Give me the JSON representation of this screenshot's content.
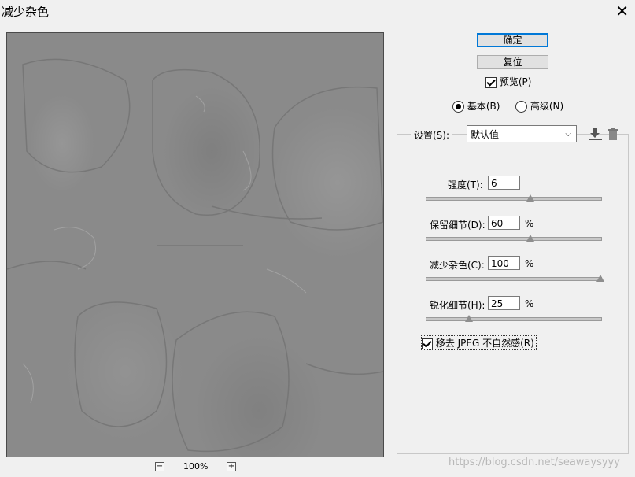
{
  "window": {
    "title": "减少杂色",
    "close_glyph": "✕"
  },
  "preview": {
    "zoom_out": "−",
    "zoom_in": "+",
    "zoom_level": "100%"
  },
  "buttons": {
    "ok": "确定",
    "reset": "复位"
  },
  "preview_toggle": {
    "label": "预览(P)",
    "checked": true
  },
  "mode": {
    "basic": "基本(B)",
    "advanced": "高级(N)",
    "selected": "basic"
  },
  "settings": {
    "label": "设置(S):",
    "value": "默认值",
    "save_icon": "save-preset-icon",
    "delete_icon": "trash-icon"
  },
  "sliders": [
    {
      "label": "强度(T):",
      "value": "6",
      "unit": "",
      "fraction": 0.6
    },
    {
      "label": "保留细节(D):",
      "value": "60",
      "unit": "%",
      "fraction": 0.6
    },
    {
      "label": "减少杂色(C):",
      "value": "100",
      "unit": "%",
      "fraction": 1.0
    },
    {
      "label": "锐化细节(H):",
      "value": "25",
      "unit": "%",
      "fraction": 0.25
    }
  ],
  "jpeg_artifact": {
    "label": "移去 JPEG 不自然感(R)",
    "checked": true
  },
  "watermark": "https://blog.csdn.net/seawaysyyy"
}
